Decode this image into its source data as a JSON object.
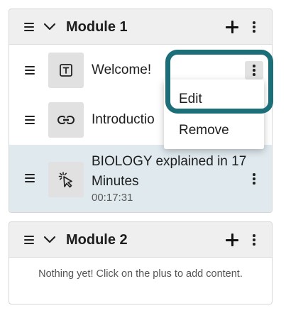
{
  "modules": [
    {
      "title": "Module 1",
      "items": [
        {
          "label": "Welcome!",
          "icon": "text-icon"
        },
        {
          "label": "Introductio",
          "icon": "link-icon"
        },
        {
          "label": "BIOLOGY explained in 17 Minutes",
          "duration": "00:17:31",
          "icon": "interactive-video-icon"
        }
      ]
    },
    {
      "title": "Module 2",
      "empty_message": "Nothing yet! Click on the plus to add content."
    }
  ],
  "context_menu": {
    "items": [
      "Edit",
      "Remove"
    ]
  },
  "colors": {
    "header_bg": "#efefef",
    "selected_row_bg": "#dfe9ee",
    "highlight_ring": "#1c6f79",
    "thumb_bg": "#e1e1e1"
  }
}
